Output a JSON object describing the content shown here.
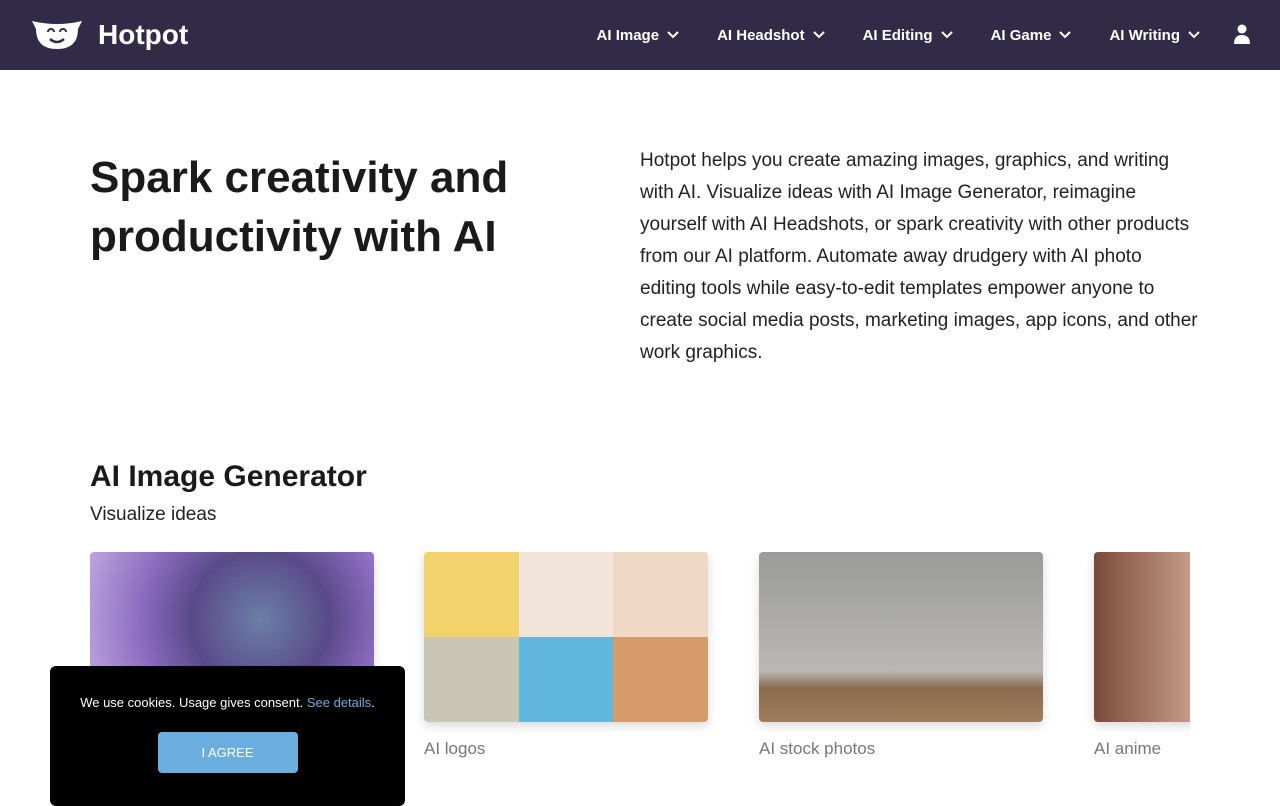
{
  "nav": {
    "brand": "Hotpot",
    "items": [
      {
        "label": "AI Image"
      },
      {
        "label": "AI Headshot"
      },
      {
        "label": "AI Editing"
      },
      {
        "label": "AI Game"
      },
      {
        "label": "AI Writing"
      }
    ],
    "user_icon": "user-icon"
  },
  "hero": {
    "title": "Spark creativity and productivity with AI",
    "text": "Hotpot helps you create amazing images, graphics, and writing with AI. Visualize ideas with AI Image Generator, reimagine yourself with AI Headshots, or spark creativity with other products from our AI platform. Automate away drudgery with AI photo editing tools while easy-to-edit templates empower anyone to create social media posts, marketing images, app icons, and other work graphics."
  },
  "section": {
    "title": "AI Image Generator",
    "subtitle": "Visualize ideas",
    "cards": [
      {
        "label": ""
      },
      {
        "label": "AI logos"
      },
      {
        "label": "AI stock photos"
      },
      {
        "label": "AI anime"
      }
    ]
  },
  "cookie": {
    "text": "We use cookies. Usage gives consent. ",
    "link": "See details",
    "period": ".",
    "button": "I AGREE"
  },
  "colors": {
    "nav_bg": "#322b47",
    "accent": "#6aaee0"
  }
}
